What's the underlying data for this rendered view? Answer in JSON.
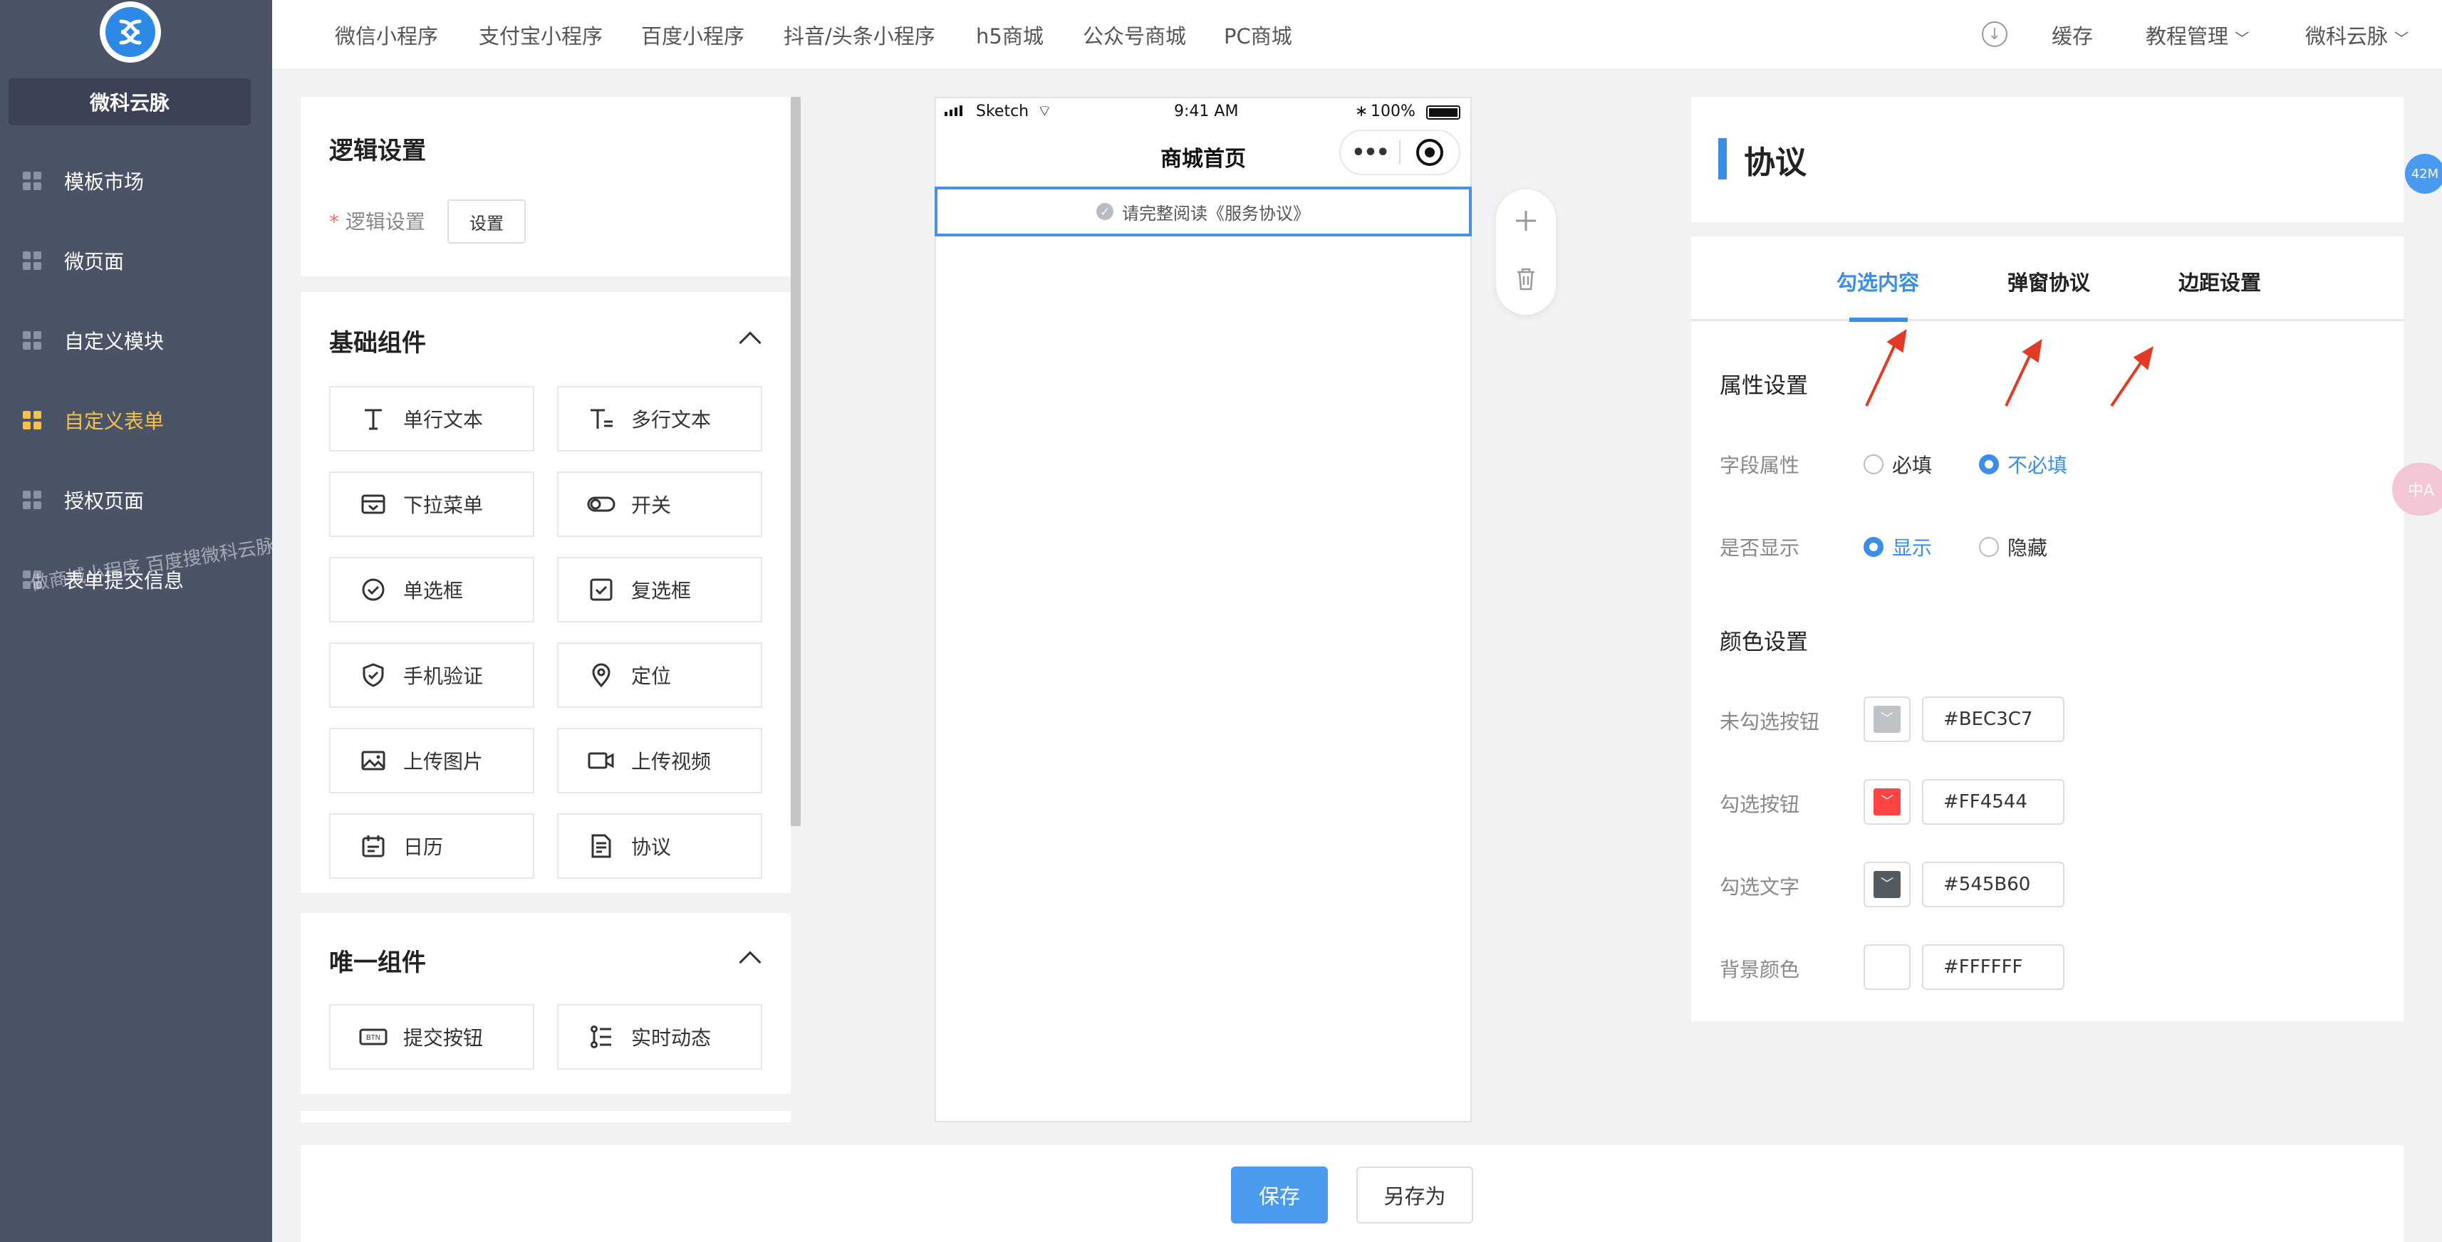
{
  "brand": {
    "name": "微科云脉"
  },
  "sidebar": {
    "items": [
      {
        "label": "模板市场"
      },
      {
        "label": "微页面"
      },
      {
        "label": "自定义模块"
      },
      {
        "label": "自定义表单",
        "active": true
      },
      {
        "label": "授权页面"
      },
      {
        "label": "表单提交信息"
      }
    ],
    "watermark": "做商城小程序 百度搜微科云脉"
  },
  "topnav": {
    "tabs": [
      "微信小程序",
      "支付宝小程序",
      "百度小程序",
      "抖音/头条小程序",
      "h5商城",
      "公众号商城",
      "PC商城"
    ],
    "cache": "缓存",
    "tutorial": "教程管理",
    "user": "微科云脉"
  },
  "logic": {
    "title": "逻辑设置",
    "label": "逻辑设置",
    "button": "设置"
  },
  "basic": {
    "title": "基础组件",
    "items": [
      "单行文本",
      "多行文本",
      "下拉菜单",
      "开关",
      "单选框",
      "复选框",
      "手机验证",
      "定位",
      "上传图片",
      "上传视频",
      "日历",
      "协议"
    ]
  },
  "unique": {
    "title": "唯一组件",
    "items": [
      "提交按钮",
      "实时动态"
    ]
  },
  "phone": {
    "carrier": "Sketch",
    "time": "9:41 AM",
    "battery": "100%",
    "title": "商城首页",
    "agreement_text": "请完整阅读《服务协议》"
  },
  "panel": {
    "title": "协议",
    "tabs": [
      "勾选内容",
      "弹窗协议",
      "边距设置"
    ],
    "active_tab": "勾选内容",
    "attr_section": "属性设置",
    "field_attr": {
      "label": "字段属性",
      "options": [
        "必填",
        "不必填"
      ],
      "selected": "不必填"
    },
    "display": {
      "label": "是否显示",
      "options": [
        "显示",
        "隐藏"
      ],
      "selected": "显示"
    },
    "color_section": "颜色设置",
    "colors": [
      {
        "label": "未勾选按钮",
        "value": "#BEC3C7"
      },
      {
        "label": "勾选按钮",
        "value": "#FF4544"
      },
      {
        "label": "勾选文字",
        "value": "#545B60"
      },
      {
        "label": "背景颜色",
        "value": "#FFFFFF"
      }
    ]
  },
  "footer": {
    "save": "保存",
    "save_as": "另存为"
  },
  "edge": {
    "memory_badge": "42M"
  }
}
